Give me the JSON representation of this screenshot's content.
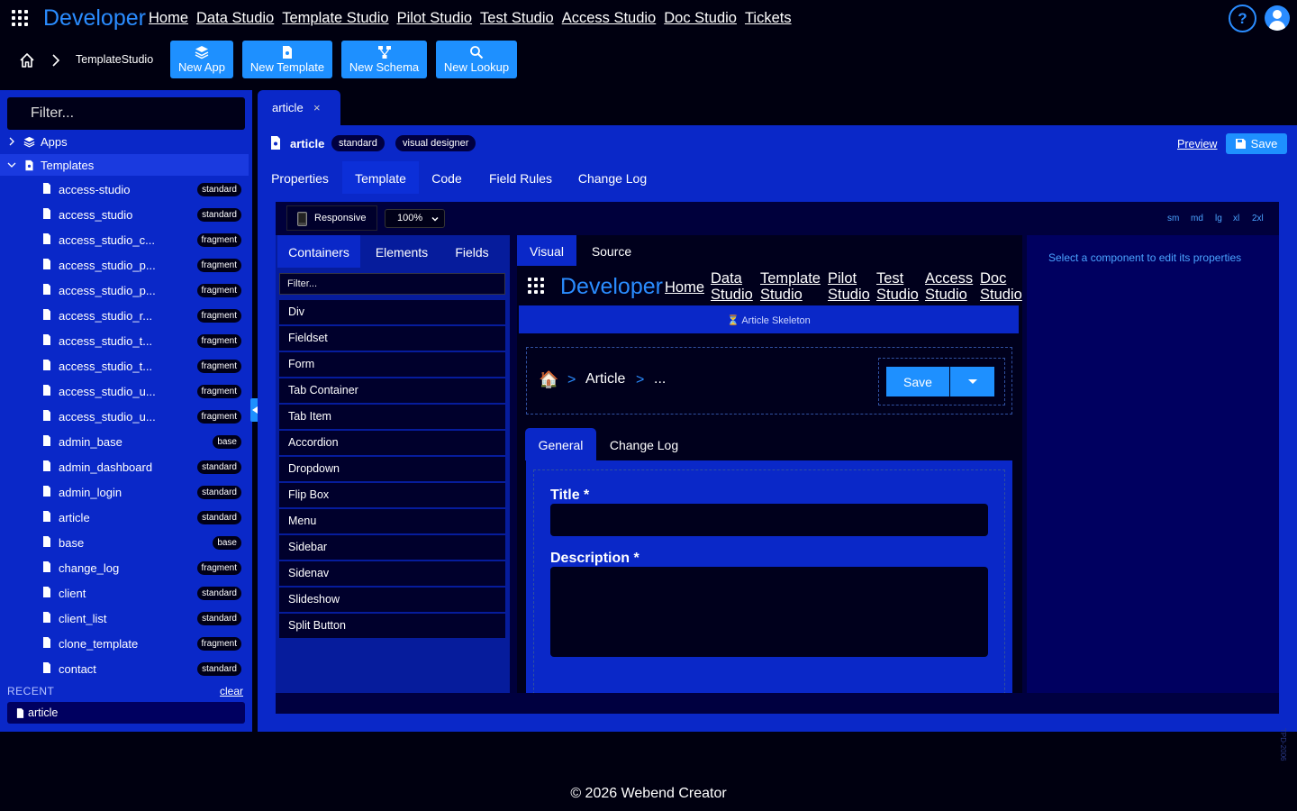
{
  "topnav": {
    "brand": "Developer",
    "links": [
      "Home",
      "Data Studio",
      "Template Studio",
      "Pilot Studio",
      "Test Studio",
      "Access Studio",
      "Doc Studio",
      "Tickets"
    ],
    "help": "?"
  },
  "toolbar": {
    "breadcrumb": "TemplateStudio",
    "buttons": [
      "New App",
      "New Template",
      "New Schema",
      "New Lookup"
    ]
  },
  "sidebar": {
    "filter_placeholder": "Filter...",
    "apps_label": "Apps",
    "templates_label": "Templates",
    "templates": [
      {
        "name": "access-studio",
        "badge": "standard"
      },
      {
        "name": "access_studio",
        "badge": "standard"
      },
      {
        "name": "access_studio_c...",
        "badge": "fragment"
      },
      {
        "name": "access_studio_p...",
        "badge": "fragment"
      },
      {
        "name": "access_studio_p...",
        "badge": "fragment"
      },
      {
        "name": "access_studio_r...",
        "badge": "fragment"
      },
      {
        "name": "access_studio_t...",
        "badge": "fragment"
      },
      {
        "name": "access_studio_t...",
        "badge": "fragment"
      },
      {
        "name": "access_studio_u...",
        "badge": "fragment"
      },
      {
        "name": "access_studio_u...",
        "badge": "fragment"
      },
      {
        "name": "admin_base",
        "badge": "base"
      },
      {
        "name": "admin_dashboard",
        "badge": "standard"
      },
      {
        "name": "admin_login",
        "badge": "standard"
      },
      {
        "name": "article",
        "badge": "standard"
      },
      {
        "name": "base",
        "badge": "base"
      },
      {
        "name": "change_log",
        "badge": "fragment"
      },
      {
        "name": "client",
        "badge": "standard"
      },
      {
        "name": "client_list",
        "badge": "standard"
      },
      {
        "name": "clone_template",
        "badge": "fragment"
      },
      {
        "name": "contact",
        "badge": "standard"
      }
    ],
    "recent_title": "RECENT",
    "recent_clear": "clear",
    "recent_items": [
      "article"
    ]
  },
  "doc_tab": {
    "label": "article",
    "close": "×"
  },
  "header": {
    "title": "article",
    "pills": [
      "standard",
      "visual designer"
    ],
    "preview": "Preview",
    "save": "Save"
  },
  "main_tabs": [
    "Properties",
    "Template",
    "Code",
    "Field Rules",
    "Change Log"
  ],
  "designer": {
    "responsive": "Responsive",
    "zoom": "100%",
    "breakpoints": [
      "sm",
      "md",
      "lg",
      "xl",
      "2xl"
    ],
    "panel_tabs": [
      "Containers",
      "Elements",
      "Fields"
    ],
    "filter_placeholder": "Filter...",
    "components": [
      "Div",
      "Fieldset",
      "Form",
      "Tab Container",
      "Tab Item",
      "Accordion",
      "Dropdown",
      "Flip Box",
      "Menu",
      "Sidebar",
      "Sidenav",
      "Slideshow",
      "Split Button"
    ],
    "canvas_tabs": [
      "Visual",
      "Source"
    ],
    "right_hint": "Select a component to edit its properties"
  },
  "preview": {
    "brand": "Developer",
    "links": [
      [
        "Home",
        ""
      ],
      [
        "Data",
        "Studio"
      ],
      [
        "Template",
        "Studio"
      ],
      [
        "Pilot",
        "Studio"
      ],
      [
        "Test",
        "Studio"
      ],
      [
        "Access",
        "Studio"
      ],
      [
        "Doc",
        "Studio"
      ]
    ],
    "skeleton": "⏳ Article Skeleton",
    "breadcrumb": [
      "🏠",
      ">",
      "Article",
      ">",
      "..."
    ],
    "save": "Save",
    "tabs": [
      "General",
      "Change Log"
    ],
    "fields": [
      "Title *",
      "Description *"
    ]
  },
  "footer": "© 2026 Webend Creator",
  "side_code": "TPD-2006"
}
